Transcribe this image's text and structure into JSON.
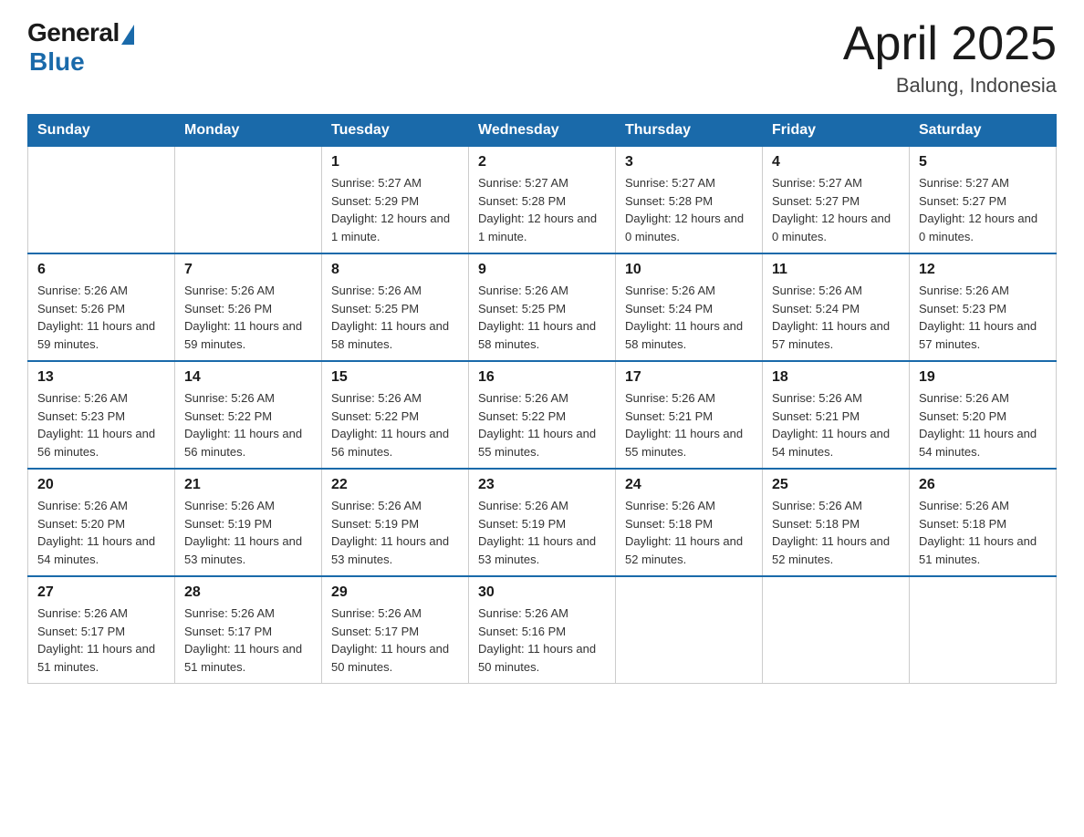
{
  "header": {
    "logo_general": "General",
    "logo_blue": "Blue",
    "month_title": "April 2025",
    "location": "Balung, Indonesia"
  },
  "weekdays": [
    "Sunday",
    "Monday",
    "Tuesday",
    "Wednesday",
    "Thursday",
    "Friday",
    "Saturday"
  ],
  "weeks": [
    [
      {
        "day": "",
        "info": ""
      },
      {
        "day": "",
        "info": ""
      },
      {
        "day": "1",
        "info": "Sunrise: 5:27 AM\nSunset: 5:29 PM\nDaylight: 12 hours\nand 1 minute."
      },
      {
        "day": "2",
        "info": "Sunrise: 5:27 AM\nSunset: 5:28 PM\nDaylight: 12 hours\nand 1 minute."
      },
      {
        "day": "3",
        "info": "Sunrise: 5:27 AM\nSunset: 5:28 PM\nDaylight: 12 hours\nand 0 minutes."
      },
      {
        "day": "4",
        "info": "Sunrise: 5:27 AM\nSunset: 5:27 PM\nDaylight: 12 hours\nand 0 minutes."
      },
      {
        "day": "5",
        "info": "Sunrise: 5:27 AM\nSunset: 5:27 PM\nDaylight: 12 hours\nand 0 minutes."
      }
    ],
    [
      {
        "day": "6",
        "info": "Sunrise: 5:26 AM\nSunset: 5:26 PM\nDaylight: 11 hours\nand 59 minutes."
      },
      {
        "day": "7",
        "info": "Sunrise: 5:26 AM\nSunset: 5:26 PM\nDaylight: 11 hours\nand 59 minutes."
      },
      {
        "day": "8",
        "info": "Sunrise: 5:26 AM\nSunset: 5:25 PM\nDaylight: 11 hours\nand 58 minutes."
      },
      {
        "day": "9",
        "info": "Sunrise: 5:26 AM\nSunset: 5:25 PM\nDaylight: 11 hours\nand 58 minutes."
      },
      {
        "day": "10",
        "info": "Sunrise: 5:26 AM\nSunset: 5:24 PM\nDaylight: 11 hours\nand 58 minutes."
      },
      {
        "day": "11",
        "info": "Sunrise: 5:26 AM\nSunset: 5:24 PM\nDaylight: 11 hours\nand 57 minutes."
      },
      {
        "day": "12",
        "info": "Sunrise: 5:26 AM\nSunset: 5:23 PM\nDaylight: 11 hours\nand 57 minutes."
      }
    ],
    [
      {
        "day": "13",
        "info": "Sunrise: 5:26 AM\nSunset: 5:23 PM\nDaylight: 11 hours\nand 56 minutes."
      },
      {
        "day": "14",
        "info": "Sunrise: 5:26 AM\nSunset: 5:22 PM\nDaylight: 11 hours\nand 56 minutes."
      },
      {
        "day": "15",
        "info": "Sunrise: 5:26 AM\nSunset: 5:22 PM\nDaylight: 11 hours\nand 56 minutes."
      },
      {
        "day": "16",
        "info": "Sunrise: 5:26 AM\nSunset: 5:22 PM\nDaylight: 11 hours\nand 55 minutes."
      },
      {
        "day": "17",
        "info": "Sunrise: 5:26 AM\nSunset: 5:21 PM\nDaylight: 11 hours\nand 55 minutes."
      },
      {
        "day": "18",
        "info": "Sunrise: 5:26 AM\nSunset: 5:21 PM\nDaylight: 11 hours\nand 54 minutes."
      },
      {
        "day": "19",
        "info": "Sunrise: 5:26 AM\nSunset: 5:20 PM\nDaylight: 11 hours\nand 54 minutes."
      }
    ],
    [
      {
        "day": "20",
        "info": "Sunrise: 5:26 AM\nSunset: 5:20 PM\nDaylight: 11 hours\nand 54 minutes."
      },
      {
        "day": "21",
        "info": "Sunrise: 5:26 AM\nSunset: 5:19 PM\nDaylight: 11 hours\nand 53 minutes."
      },
      {
        "day": "22",
        "info": "Sunrise: 5:26 AM\nSunset: 5:19 PM\nDaylight: 11 hours\nand 53 minutes."
      },
      {
        "day": "23",
        "info": "Sunrise: 5:26 AM\nSunset: 5:19 PM\nDaylight: 11 hours\nand 53 minutes."
      },
      {
        "day": "24",
        "info": "Sunrise: 5:26 AM\nSunset: 5:18 PM\nDaylight: 11 hours\nand 52 minutes."
      },
      {
        "day": "25",
        "info": "Sunrise: 5:26 AM\nSunset: 5:18 PM\nDaylight: 11 hours\nand 52 minutes."
      },
      {
        "day": "26",
        "info": "Sunrise: 5:26 AM\nSunset: 5:18 PM\nDaylight: 11 hours\nand 51 minutes."
      }
    ],
    [
      {
        "day": "27",
        "info": "Sunrise: 5:26 AM\nSunset: 5:17 PM\nDaylight: 11 hours\nand 51 minutes."
      },
      {
        "day": "28",
        "info": "Sunrise: 5:26 AM\nSunset: 5:17 PM\nDaylight: 11 hours\nand 51 minutes."
      },
      {
        "day": "29",
        "info": "Sunrise: 5:26 AM\nSunset: 5:17 PM\nDaylight: 11 hours\nand 50 minutes."
      },
      {
        "day": "30",
        "info": "Sunrise: 5:26 AM\nSunset: 5:16 PM\nDaylight: 11 hours\nand 50 minutes."
      },
      {
        "day": "",
        "info": ""
      },
      {
        "day": "",
        "info": ""
      },
      {
        "day": "",
        "info": ""
      }
    ]
  ]
}
